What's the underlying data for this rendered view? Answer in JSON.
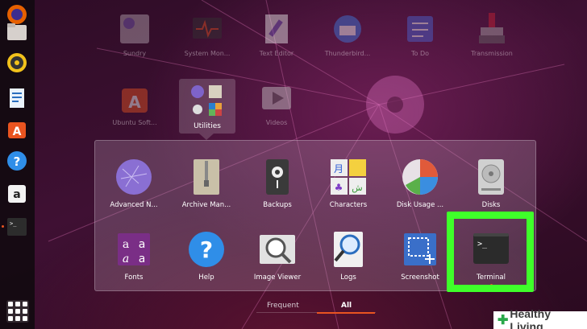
{
  "top_apps": [
    {
      "label": "Sundry",
      "icon": "sundry-folder-icon"
    },
    {
      "label": "System Mon...",
      "icon": "system-monitor-icon"
    },
    {
      "label": "Text Editor",
      "icon": "text-editor-icon"
    },
    {
      "label": "Thunderbird...",
      "icon": "thunderbird-icon"
    },
    {
      "label": "To Do",
      "icon": "todo-icon"
    },
    {
      "label": "Transmission",
      "icon": "transmission-icon"
    },
    {
      "label": "Ubuntu Soft...",
      "icon": "ubuntu-software-icon"
    },
    {
      "label": "Utilities",
      "icon": "utilities-folder-icon"
    },
    {
      "label": "Videos",
      "icon": "videos-icon"
    }
  ],
  "utilities": [
    {
      "label": "Advanced N...",
      "icon": "advanced-network-icon"
    },
    {
      "label": "Archive Man...",
      "icon": "archive-manager-icon"
    },
    {
      "label": "Backups",
      "icon": "backups-icon"
    },
    {
      "label": "Characters",
      "icon": "characters-icon"
    },
    {
      "label": "Disk Usage ...",
      "icon": "disk-usage-icon"
    },
    {
      "label": "Disks",
      "icon": "disks-icon"
    },
    {
      "label": "Fonts",
      "icon": "fonts-icon"
    },
    {
      "label": "Help",
      "icon": "help-icon"
    },
    {
      "label": "Image Viewer",
      "icon": "image-viewer-icon"
    },
    {
      "label": "Logs",
      "icon": "logs-icon"
    },
    {
      "label": "Screenshot",
      "icon": "screenshot-icon"
    },
    {
      "label": "Terminal",
      "icon": "terminal-icon"
    }
  ],
  "tabs": {
    "frequent": "Frequent",
    "all": "All"
  },
  "watermark": {
    "plus": "✚",
    "text": "Healthy Living"
  },
  "colors": {
    "accent": "#e95420",
    "highlight": "#3fff2a"
  }
}
